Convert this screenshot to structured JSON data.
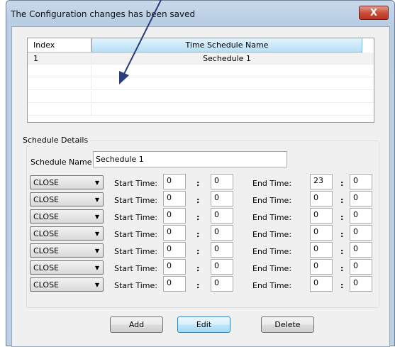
{
  "window": {
    "title": "The Configuration changes has been saved",
    "close_label": "X"
  },
  "grid": {
    "columns": [
      "Index",
      "Time Schedule Name"
    ],
    "rows": [
      {
        "index": "1",
        "name": "Sechedule 1"
      }
    ]
  },
  "details": {
    "legend": "Schedule Details",
    "schedule_name_label": "Schedule Name",
    "schedule_name_value": "Sechedule 1",
    "start_label": "Start Time:",
    "end_label": "End Time:",
    "colon": ":",
    "rows": [
      {
        "mode": "CLOSE",
        "start_h": "0",
        "start_m": "0",
        "end_h": "23",
        "end_m": "0"
      },
      {
        "mode": "CLOSE",
        "start_h": "0",
        "start_m": "0",
        "end_h": "0",
        "end_m": "0"
      },
      {
        "mode": "CLOSE",
        "start_h": "0",
        "start_m": "0",
        "end_h": "0",
        "end_m": "0"
      },
      {
        "mode": "CLOSE",
        "start_h": "0",
        "start_m": "0",
        "end_h": "0",
        "end_m": "0"
      },
      {
        "mode": "CLOSE",
        "start_h": "0",
        "start_m": "0",
        "end_h": "0",
        "end_m": "0"
      },
      {
        "mode": "CLOSE",
        "start_h": "0",
        "start_m": "0",
        "end_h": "0",
        "end_m": "0"
      },
      {
        "mode": "CLOSE",
        "start_h": "0",
        "start_m": "0",
        "end_h": "0",
        "end_m": "0"
      }
    ]
  },
  "buttons": {
    "add": "Add",
    "edit": "Edit",
    "delete": "Delete"
  },
  "icons": {
    "combo_arrow": "chevron-down-icon",
    "annotation": "arrow-annotation-icon"
  },
  "colors": {
    "title_bar": "#b9cde3",
    "close_button": "#c7503a",
    "header_selected": "#b6dff6"
  }
}
